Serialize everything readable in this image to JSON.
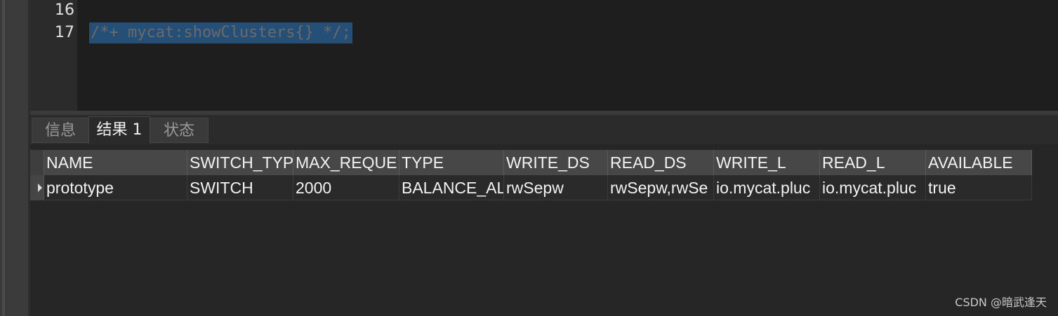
{
  "editor": {
    "line_numbers": [
      "16",
      "17"
    ],
    "code": "/*+ mycat:showClusters{} */;"
  },
  "tabs": [
    "信息",
    "结果 1",
    "状态"
  ],
  "active_tab": "结果 1",
  "grid": {
    "columns": [
      "NAME",
      "SWITCH_TYP",
      "MAX_REQUE",
      "TYPE",
      "WRITE_DS",
      "READ_DS",
      "WRITE_L",
      "READ_L",
      "AVAILABLE"
    ],
    "rows": [
      [
        "prototype",
        "SWITCH",
        "2000",
        "BALANCE_AL",
        "rwSepw",
        "rwSepw,rwSe",
        "io.mycat.pluc",
        "io.mycat.pluc",
        "true"
      ]
    ]
  },
  "watermark": "CSDN @暗武逢天"
}
